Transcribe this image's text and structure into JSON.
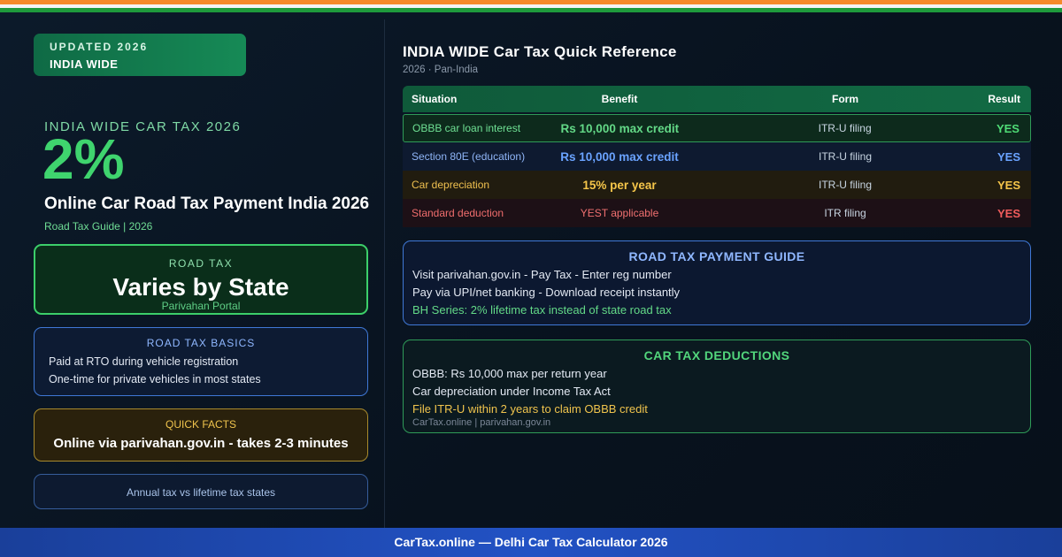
{
  "badge": {
    "line1": "UPDATED 2026",
    "line2": "INDIA WIDE"
  },
  "hero": {
    "kicker": "INDIA WIDE CAR TAX 2026",
    "big_value": "2%",
    "headline": "Online Car Road Tax Payment India 2026",
    "subline": "Road Tax Guide | 2026"
  },
  "road_tax_card": {
    "title": "ROAD TAX",
    "value": "Varies by State",
    "sub": "Parivahan Portal"
  },
  "basics_card": {
    "title": "ROAD TAX BASICS",
    "items": [
      "Paid at RTO during vehicle registration",
      "One-time for private vehicles in most states"
    ]
  },
  "facts_card": {
    "title": "QUICK FACTS",
    "value": "Online via parivahan.gov.in - takes 2-3 minutes"
  },
  "annual_card": {
    "text": "Annual tax vs lifetime tax states"
  },
  "reference": {
    "title": "INDIA WIDE Car Tax Quick Reference",
    "subtitle": "2026 · Pan-India",
    "headers": [
      "Situation",
      "Benefit",
      "Form",
      "Result"
    ],
    "rows": [
      {
        "situation": "OBBB car loan interest",
        "benefit": "Rs 10,000 max credit",
        "form": "ITR-U filing",
        "result": "YES"
      },
      {
        "situation": "Section 80E (education)",
        "benefit": "Rs 10,000 max credit",
        "form": "ITR-U filing",
        "result": "YES"
      },
      {
        "situation": "Car depreciation",
        "benefit": "15% per year",
        "form": "ITR-U filing",
        "result": "YES"
      },
      {
        "situation": "Standard deduction",
        "benefit": "YEST applicable",
        "form": "ITR filing",
        "result": "YES"
      }
    ]
  },
  "payment_guide": {
    "title": "ROAD TAX PAYMENT GUIDE",
    "items": [
      "Visit parivahan.gov.in - Pay Tax - Enter reg number",
      "Pay via UPI/net banking - Download receipt instantly",
      "BH Series: 2% lifetime tax instead of state road tax"
    ]
  },
  "deductions": {
    "title": "CAR TAX DEDUCTIONS",
    "items": [
      "OBBB: Rs 10,000 max per return year",
      "Car depreciation under Income Tax Act",
      "File ITR-U within 2 years to claim OBBB credit"
    ],
    "source": "CarTax.online | parivahan.gov.in"
  },
  "footer": {
    "text": "CarTax.online — Delhi Car Tax Calculator 2026"
  },
  "colors": {
    "accent_green": "#3fd46e",
    "accent_blue": "#6aa3ff",
    "accent_gold": "#f6c64a",
    "accent_red": "#f05c5c",
    "footer_blue": "#2252c4"
  }
}
